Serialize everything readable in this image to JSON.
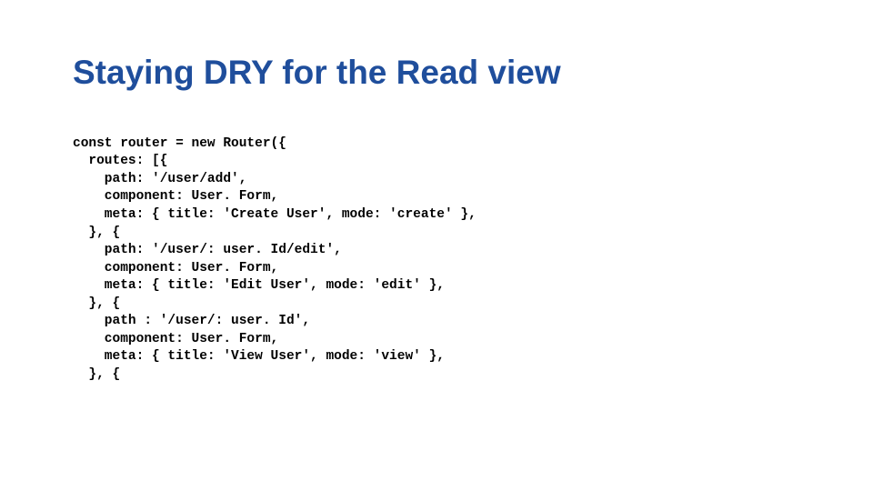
{
  "title": "Staying DRY for the Read view",
  "code": {
    "l1": "const router = new Router({",
    "l2": "  routes: [{",
    "l3": "    path: '/user/add',",
    "l4": "    component: User. Form,",
    "l5": "    meta: { title: 'Create User', mode: 'create' },",
    "l6": "  }, {",
    "l7": "    path: '/user/: user. Id/edit',",
    "l8": "    component: User. Form,",
    "l9": "    meta: { title: 'Edit User', mode: 'edit' },",
    "l10": "  }, {",
    "l11": "    path : '/user/: user. Id',",
    "l12": "    component: User. Form,",
    "l13": "    meta: { title: 'View User', mode: 'view' },",
    "l14": "  }, {"
  }
}
